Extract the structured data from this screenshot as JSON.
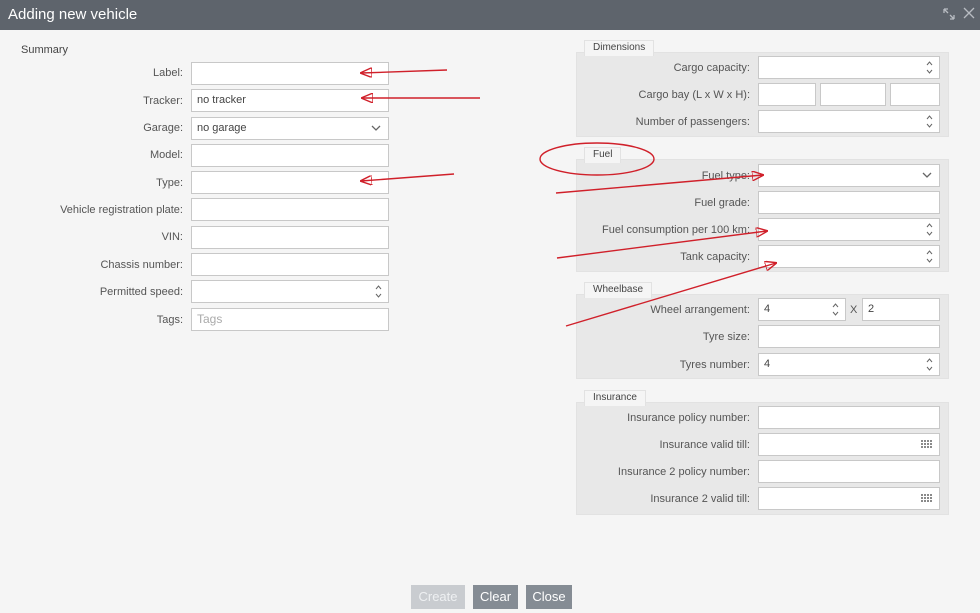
{
  "window": {
    "title": "Adding new vehicle"
  },
  "summary": {
    "heading": "Summary",
    "label": {
      "label": "Label:",
      "value": ""
    },
    "tracker": {
      "label": "Tracker:",
      "value": "no tracker"
    },
    "garage": {
      "label": "Garage:",
      "value": "no garage"
    },
    "model": {
      "label": "Model:",
      "value": ""
    },
    "type": {
      "label": "Type:",
      "value": ""
    },
    "registration_plate": {
      "label": "Vehicle registration plate:",
      "value": ""
    },
    "vin": {
      "label": "VIN:",
      "value": ""
    },
    "chassis_number": {
      "label": "Chassis number:",
      "value": ""
    },
    "permitted_speed": {
      "label": "Permitted speed:",
      "value": ""
    },
    "tags": {
      "label": "Tags:",
      "placeholder": "Tags"
    }
  },
  "dimensions": {
    "legend": "Dimensions",
    "cargo_capacity": {
      "label": "Cargo capacity:",
      "value": ""
    },
    "cargo_bay": {
      "label": "Cargo bay (L x W x H):",
      "l": "",
      "w": "",
      "h": ""
    },
    "passengers": {
      "label": "Number of passengers:",
      "value": ""
    }
  },
  "fuel": {
    "legend": "Fuel",
    "fuel_type": {
      "label": "Fuel type:",
      "value": ""
    },
    "fuel_grade": {
      "label": "Fuel grade:",
      "value": ""
    },
    "consumption": {
      "label": "Fuel consumption per 100 km:",
      "value": ""
    },
    "tank_capacity": {
      "label": "Tank capacity:",
      "value": ""
    }
  },
  "wheelbase": {
    "legend": "Wheelbase",
    "wheel_arrangement": {
      "label": "Wheel arrangement:",
      "value1": "4",
      "separator": "X",
      "value2": "2"
    },
    "tyre_size": {
      "label": "Tyre size:",
      "value": ""
    },
    "tyres_number": {
      "label": "Tyres number:",
      "value": "4"
    }
  },
  "insurance": {
    "legend": "Insurance",
    "policy_number": {
      "label": "Insurance policy number:",
      "value": ""
    },
    "valid_till": {
      "label": "Insurance valid till:",
      "value": ""
    },
    "policy2_number": {
      "label": "Insurance 2 policy number:",
      "value": ""
    },
    "valid2_till": {
      "label": "Insurance 2 valid till:",
      "value": ""
    }
  },
  "buttons": {
    "create": "Create",
    "clear": "Clear",
    "close": "Close"
  },
  "colors": {
    "titlebar": "#5e646c",
    "annotation": "#d0202a",
    "button": "#858c94",
    "button_disabled": "#c9ccd0"
  },
  "icons": {
    "maximize": "expand-arrows-icon",
    "close": "close-x-icon"
  }
}
